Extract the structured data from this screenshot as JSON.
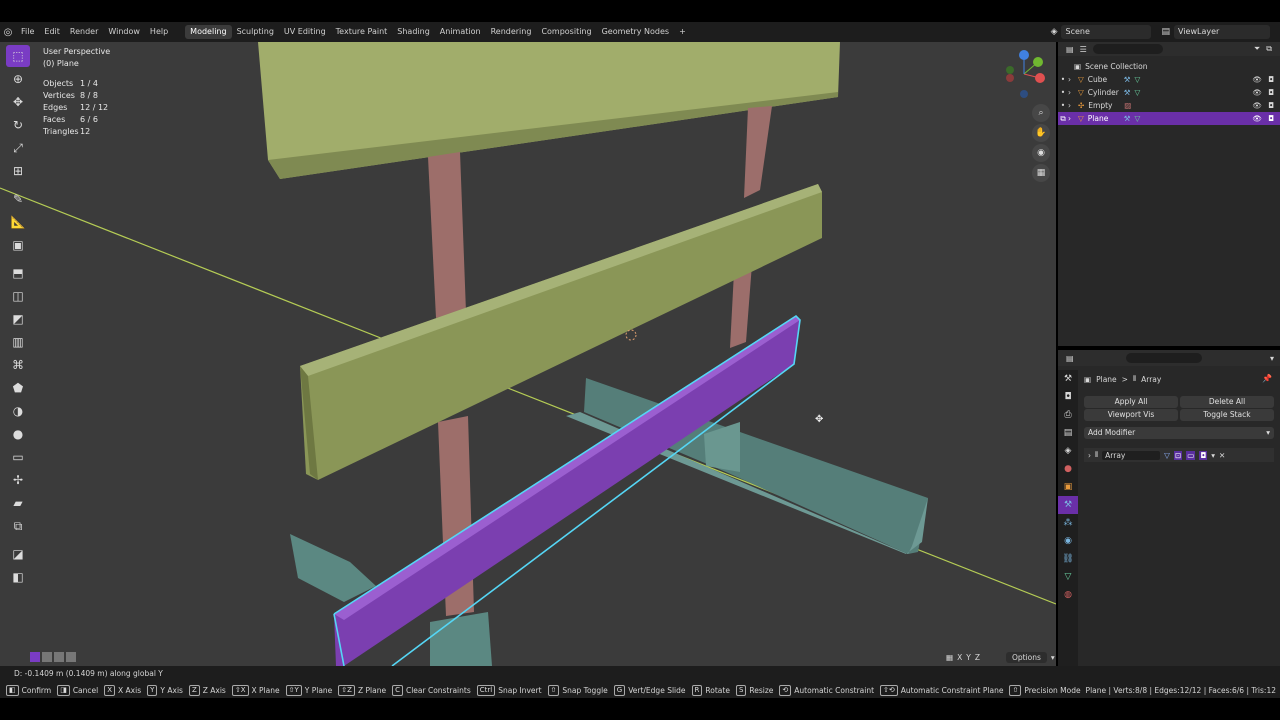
{
  "menu": [
    "File",
    "Edit",
    "Render",
    "Window",
    "Help"
  ],
  "workspaces": [
    "Modeling",
    "Sculpting",
    "UV Editing",
    "Texture Paint",
    "Shading",
    "Animation",
    "Rendering",
    "Compositing",
    "Geometry Nodes"
  ],
  "active_workspace": "Modeling",
  "add_workspace": "+",
  "scene": {
    "label": "Scene",
    "viewlayer": "ViewLayer"
  },
  "viewport": {
    "view_name": "User Perspective",
    "object_name": "(0) Plane",
    "stats": [
      {
        "label": "Objects",
        "value": "1 / 4"
      },
      {
        "label": "Vertices",
        "value": "8 / 8"
      },
      {
        "label": "Edges",
        "value": "12 / 12"
      },
      {
        "label": "Faces",
        "value": "6 / 6"
      },
      {
        "label": "Triangles",
        "value": "12"
      }
    ],
    "axis_x": "X",
    "axis_y": "Y",
    "axis_z": "Z",
    "options": "Options"
  },
  "outliner": {
    "collection": "Scene Collection",
    "items": [
      {
        "name": "Cube",
        "selected": false
      },
      {
        "name": "Cylinder",
        "selected": false
      },
      {
        "name": "Empty",
        "selected": false
      },
      {
        "name": "Plane",
        "selected": true
      }
    ]
  },
  "properties": {
    "breadcrumb_object": "Plane",
    "breadcrumb_sep": ">",
    "breadcrumb_modifier": "Array",
    "apply_all": "Apply All",
    "delete_all": "Delete All",
    "viewport_vis": "Viewport Vis",
    "toggle_stack": "Toggle Stack",
    "add_modifier": "Add Modifier",
    "modifier_name": "Array"
  },
  "coord_text": "D: -0.1409 m (0.1409 m) along global Y",
  "status": [
    {
      "key": "",
      "label": "Confirm"
    },
    {
      "key": "",
      "label": "Cancel"
    },
    {
      "key": "X",
      "label": "X Axis"
    },
    {
      "key": "Y",
      "label": "Y Axis"
    },
    {
      "key": "Z",
      "label": "Z Axis"
    },
    {
      "key": "⇧X",
      "label": "X Plane"
    },
    {
      "key": "⇧Y",
      "label": "Y Plane"
    },
    {
      "key": "⇧Z",
      "label": "Z Plane"
    },
    {
      "key": "C",
      "label": "Clear Constraints"
    },
    {
      "key": "Ctrl",
      "label": "Snap Invert"
    },
    {
      "key": "⇧",
      "label": "Snap Toggle"
    },
    {
      "key": "G",
      "label": "Vert/Edge Slide"
    },
    {
      "key": "R",
      "label": "Rotate"
    },
    {
      "key": "S",
      "label": "Resize"
    },
    {
      "key": "⟲",
      "label": "Automatic Constraint"
    },
    {
      "key": "⇧⟲",
      "label": "Automatic Constraint Plane"
    },
    {
      "key": "⇧",
      "label": "Precision Mode"
    }
  ],
  "status_right": "Plane | Verts:8/8 | Edges:12/12 | Faces:6/6 | Tris:12",
  "colors": {
    "accent": "#7a3cc4",
    "selection": "#6a2fa8",
    "viewport_bg": "#3b3b3b",
    "board": "#8a9a5e",
    "post": "#9a6f6c",
    "purple_face": "#7e3fb3",
    "outline": "#4fd2f0",
    "teal": "#5f8c86"
  }
}
